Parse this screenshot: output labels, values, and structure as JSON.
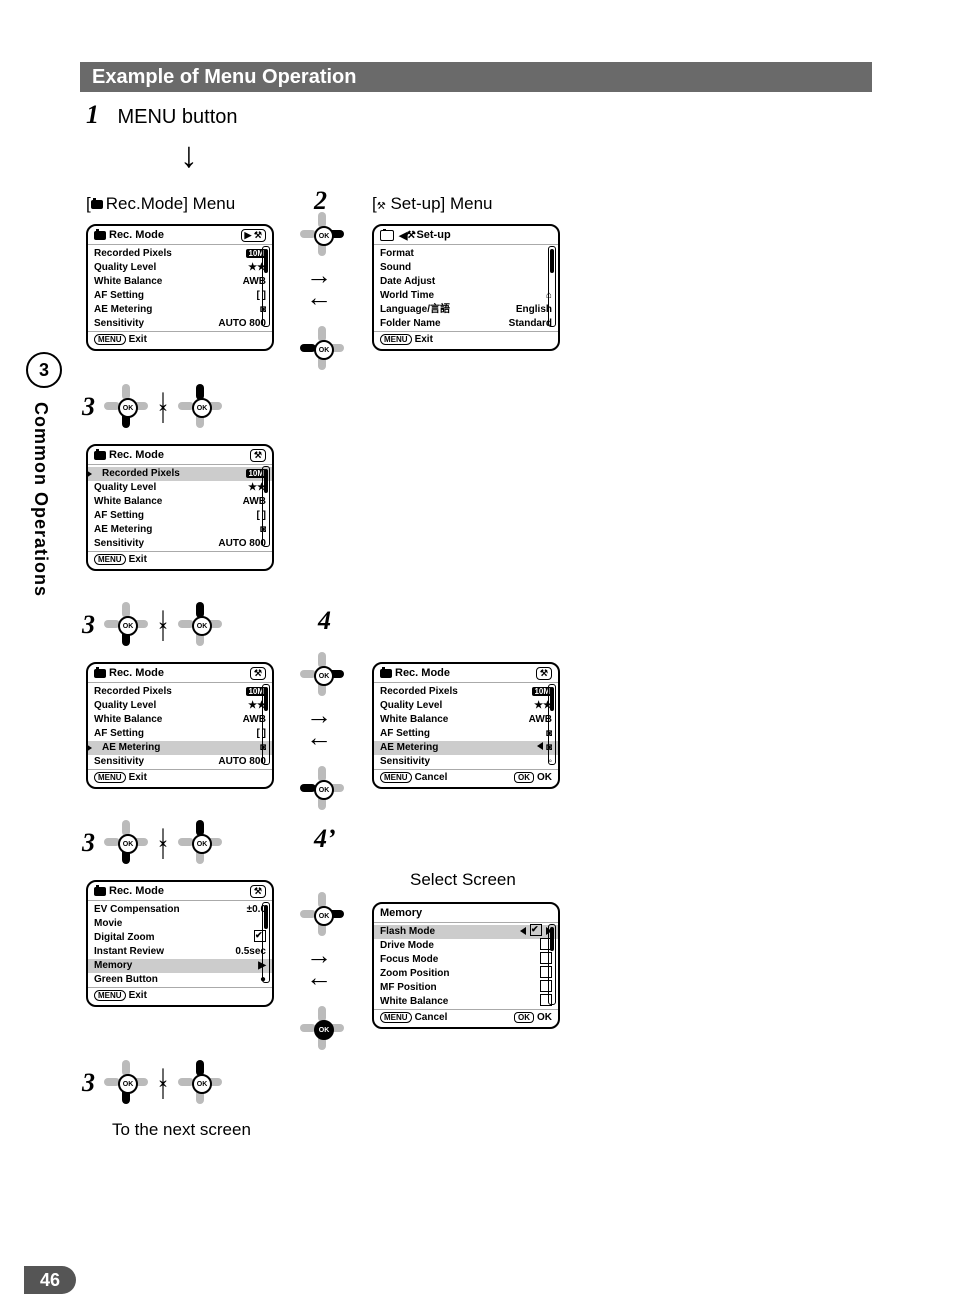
{
  "page_number": "46",
  "side": {
    "chapter_number": "3",
    "chapter_title": "Common Operations"
  },
  "title_bar": "Example of Menu Operation",
  "step1": {
    "num": "1",
    "label": "MENU button"
  },
  "rec_mode_menu_label": "Rec.Mode] Menu",
  "step2": {
    "num": "2"
  },
  "setup_menu_label": "Set-up] Menu",
  "lcd_rec_title": "Rec. Mode",
  "lcd_setup_title": "Set-up",
  "rec_rows": [
    {
      "label": "Recorded Pixels",
      "value": "10M",
      "badge": true
    },
    {
      "label": "Quality Level",
      "value": "★★"
    },
    {
      "label": "White Balance",
      "value": "AWB"
    },
    {
      "label": "AF Setting",
      "value": "[  ]"
    },
    {
      "label": "AE Metering",
      "value": "◙"
    },
    {
      "label": "Sensitivity",
      "value": "AUTO 800"
    }
  ],
  "setup_rows": [
    {
      "label": "Format",
      "value": ""
    },
    {
      "label": "Sound",
      "value": ""
    },
    {
      "label": "Date Adjust",
      "value": ""
    },
    {
      "label": "World Time",
      "value": "⌂"
    },
    {
      "label": "Language/言語",
      "value": "English"
    },
    {
      "label": "Folder Name",
      "value": "Standard"
    }
  ],
  "rec_page2_rows": [
    {
      "label": "EV Compensation",
      "value": "±0.0"
    },
    {
      "label": "Movie",
      "value": ""
    },
    {
      "label": "Digital Zoom",
      "value": "check"
    },
    {
      "label": "Instant Review",
      "value": "0.5sec"
    },
    {
      "label": "Memory",
      "value": "▶",
      "sel": true
    },
    {
      "label": "Green Button",
      "value": "●"
    }
  ],
  "ae_select_rows": [
    {
      "label": "Recorded Pixels",
      "value": "10M",
      "badge": true
    },
    {
      "label": "Quality Level",
      "value": "★★"
    },
    {
      "label": "White Balance",
      "value": "AWB"
    },
    {
      "label": "AF Setting",
      "value": "◙"
    },
    {
      "label": "AE Metering",
      "value": "◙",
      "sel": true,
      "arrows": true
    },
    {
      "label": "Sensitivity",
      "value": "◦"
    }
  ],
  "memory_title": "Memory",
  "memory_rows": [
    {
      "label": "Flash Mode",
      "checked": true,
      "sel": true,
      "arrows": true
    },
    {
      "label": "Drive Mode",
      "checked": false
    },
    {
      "label": "Focus Mode",
      "checked": false
    },
    {
      "label": "Zoom Position",
      "checked": false
    },
    {
      "label": "MF Position",
      "checked": false
    },
    {
      "label": "White Balance",
      "checked": false
    }
  ],
  "foot_exit": "Exit",
  "foot_cancel": "Cancel",
  "foot_ok": "OK",
  "foot_menu": "MENU",
  "foot_ok_pill": "OK",
  "step3": "3",
  "step4": "4",
  "step4p": "4’",
  "select_screen_label": "Select Screen",
  "bottom_label": "To the next screen"
}
